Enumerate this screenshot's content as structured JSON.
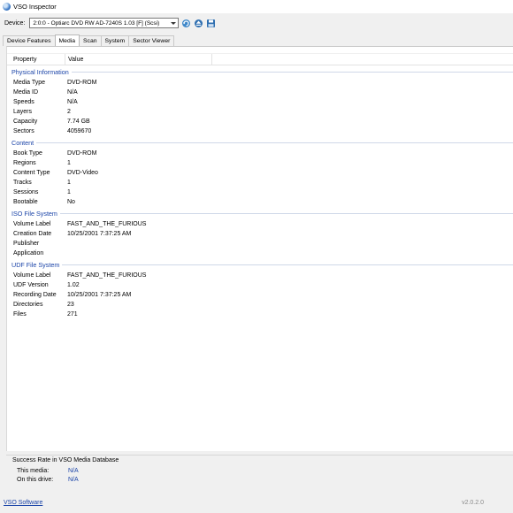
{
  "window": {
    "title": "VSO Inspector"
  },
  "device": {
    "label": "Device:",
    "selected": "2:0:0 - Optiarc DVD RW AD-7240S 1.03 [F] (Scsi)",
    "icons": [
      "refresh-icon",
      "eject-icon",
      "save-icon"
    ]
  },
  "tabs": [
    {
      "label": "Device Features",
      "active": false
    },
    {
      "label": "Media",
      "active": true
    },
    {
      "label": "Scan",
      "active": false
    },
    {
      "label": "System",
      "active": false
    },
    {
      "label": "Sector Viewer",
      "active": false
    }
  ],
  "table": {
    "col_property": "Property",
    "col_value": "Value",
    "groups": [
      {
        "title": "Physical Information",
        "rows": [
          {
            "p": "Media Type",
            "v": "DVD-ROM"
          },
          {
            "p": "Media ID",
            "v": "N/A"
          },
          {
            "p": "Speeds",
            "v": "N/A"
          },
          {
            "p": "Layers",
            "v": "2"
          },
          {
            "p": "Capacity",
            "v": "7.74 GB"
          },
          {
            "p": "Sectors",
            "v": "4059670"
          }
        ]
      },
      {
        "title": "Content",
        "rows": [
          {
            "p": "Book Type",
            "v": "DVD-ROM"
          },
          {
            "p": "Regions",
            "v": "1"
          },
          {
            "p": "Content Type",
            "v": "DVD-Video"
          },
          {
            "p": "Tracks",
            "v": "1"
          },
          {
            "p": "Sessions",
            "v": "1"
          },
          {
            "p": "Bootable",
            "v": "No"
          }
        ]
      },
      {
        "title": "ISO File System",
        "rows": [
          {
            "p": "Volume Label",
            "v": "FAST_AND_THE_FURIOUS"
          },
          {
            "p": "Creation Date",
            "v": "10/25/2001 7:37:25 AM"
          },
          {
            "p": "Publisher",
            "v": ""
          },
          {
            "p": "Application",
            "v": ""
          }
        ]
      },
      {
        "title": "UDF File System",
        "rows": [
          {
            "p": "Volume Label",
            "v": "FAST_AND_THE_FURIOUS"
          },
          {
            "p": "UDF Version",
            "v": "1.02"
          },
          {
            "p": "Recording Date",
            "v": "10/25/2001 7:37:25 AM"
          },
          {
            "p": "Directories",
            "v": "23"
          },
          {
            "p": "Files",
            "v": "271"
          }
        ]
      }
    ]
  },
  "success": {
    "title": "Success Rate in VSO Media Database",
    "this_media_label": "This media:",
    "this_media_value": "N/A",
    "this_drive_label": "On this drive:",
    "this_drive_value": "N/A"
  },
  "footer": {
    "link": "VSO Software",
    "version": "v2.0.2.0"
  },
  "colors": {
    "accent": "#1b44a8",
    "panel": "#ffffff",
    "chrome": "#f0f0f0"
  }
}
